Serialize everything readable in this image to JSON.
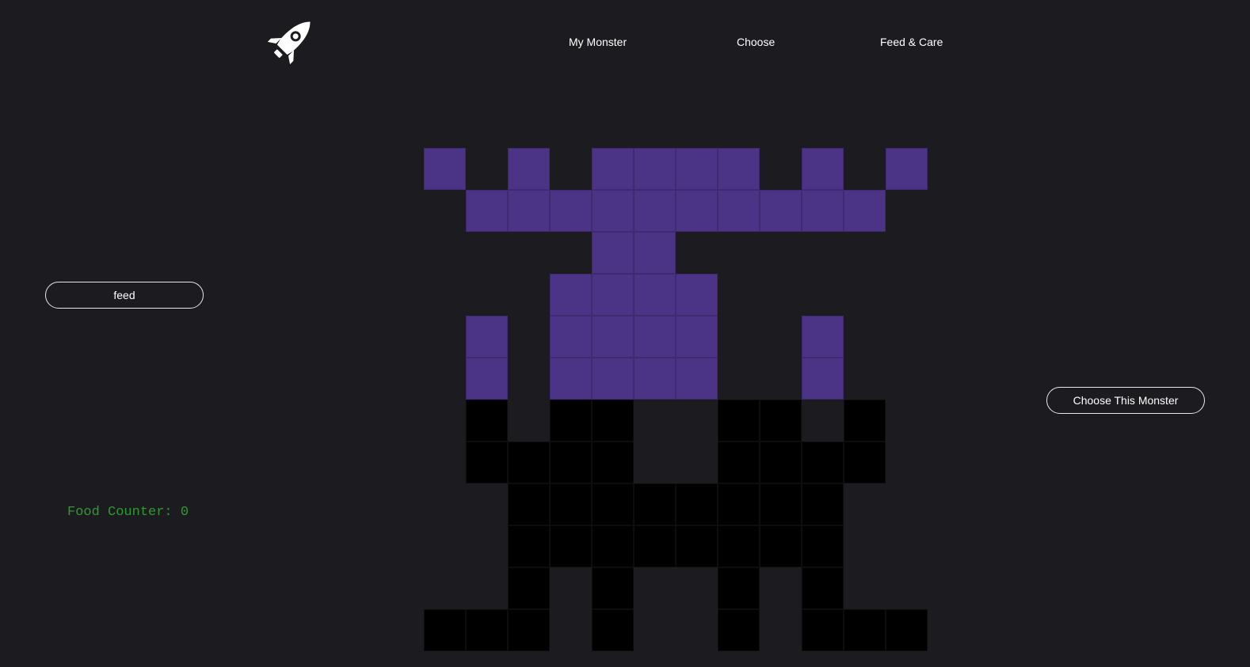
{
  "nav": {
    "logo_icon": "rocket-icon",
    "links": [
      "My Monster",
      "Choose",
      "Feed & Care"
    ]
  },
  "controls": {
    "feed_label": "feed",
    "choose_label": "Choose This Monster"
  },
  "counter": {
    "text": "Food Counter: 0"
  },
  "colors": {
    "background": "#1c1c20",
    "monster_purple": "#4b3386",
    "monster_black": "#000000",
    "counter_green": "#2f9a2f"
  },
  "monster": {
    "legend": {
      "P": "purple",
      "B": "black",
      ".": "empty"
    },
    "rows": [
      "P.P.PPPP.P.P",
      ".PPPPPPPPPP.",
      "....PP......",
      "...PPPP.....",
      ".P.PPPP..P..",
      ".P.PPPP..P..",
      ".B.BB..BB.B.",
      ".BBBB..BBBB.",
      "..BBBBBBBB..",
      "..BBBBBBBB..",
      "..B.B..B.B..",
      "BBB.B..B.BBB"
    ]
  }
}
